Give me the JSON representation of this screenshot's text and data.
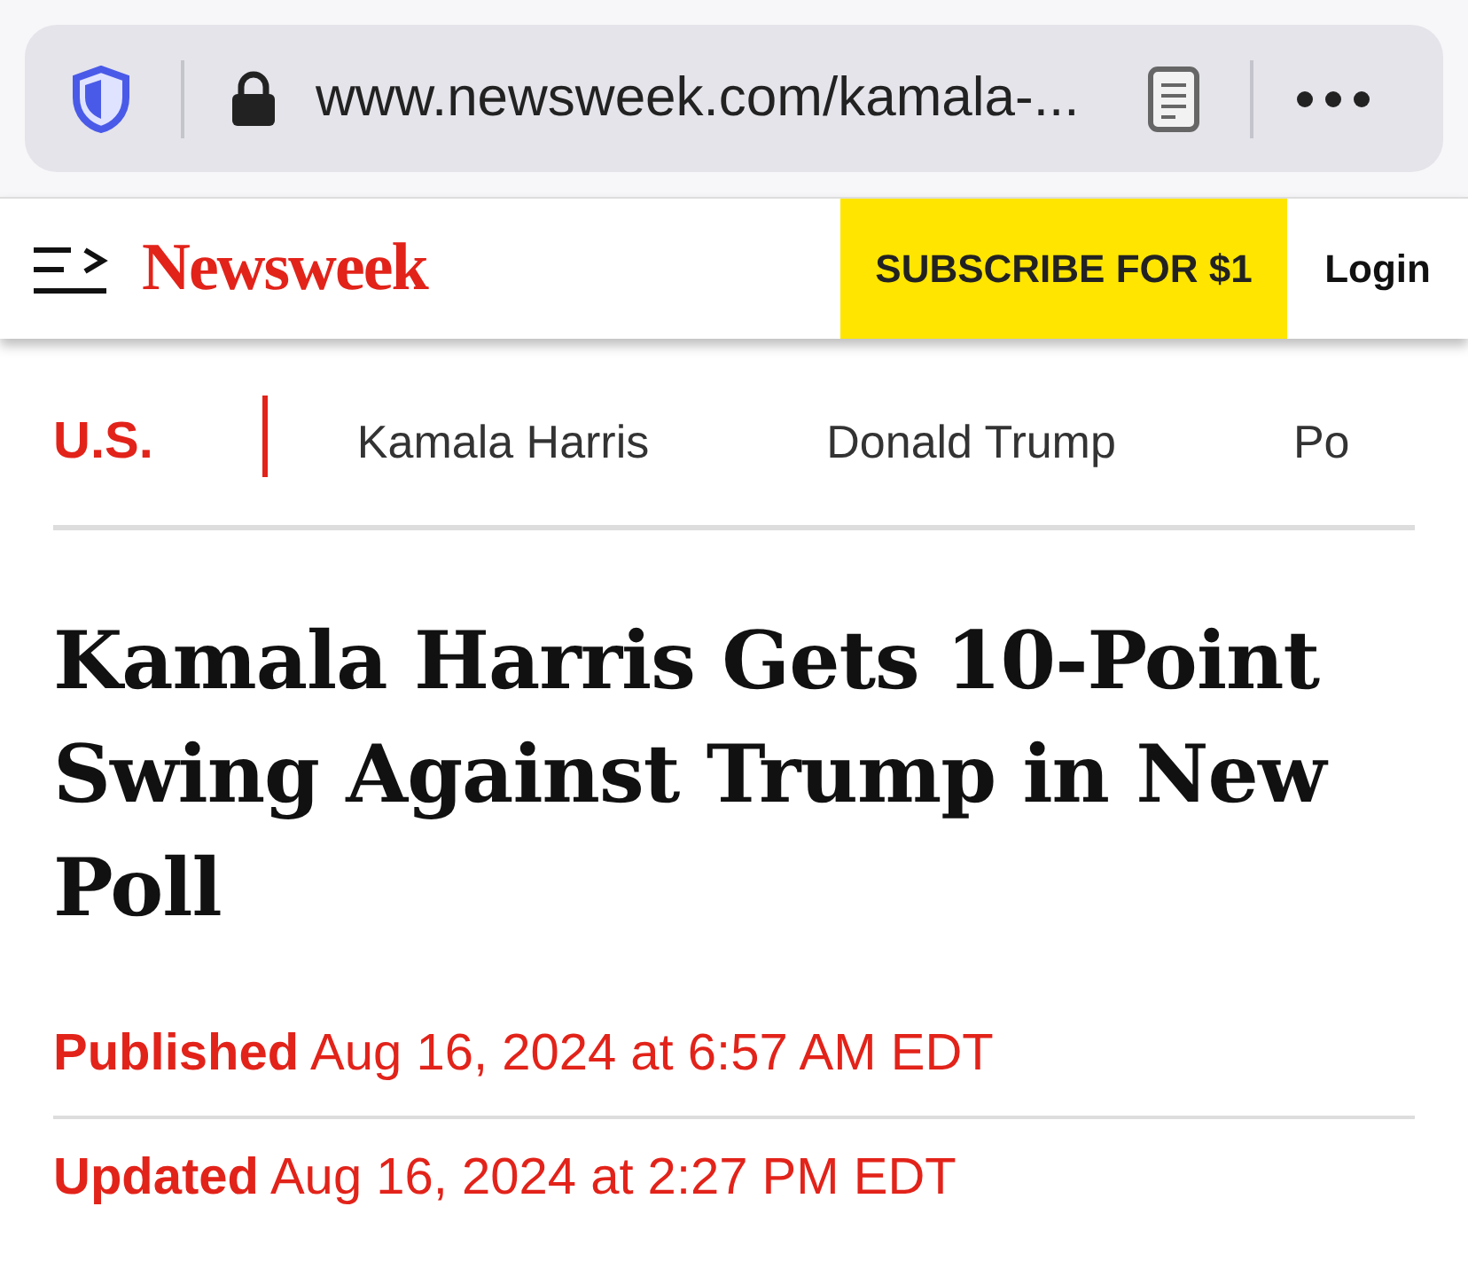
{
  "browser": {
    "url": "www.newsweek.com/kamala-..."
  },
  "header": {
    "logo": "Newsweek",
    "subscribe": "SUBSCRIBE FOR $1",
    "login": "Login"
  },
  "nav": {
    "section": "U.S.",
    "topics": [
      "Kamala Harris",
      "Donald Trump",
      "Po"
    ]
  },
  "article": {
    "headline": "Kamala Harris Gets 10-Point Swing Against Trump in New Poll",
    "dates": [
      {
        "label": "Published",
        "value": "Aug 16, 2024 at 6:57 AM EDT"
      },
      {
        "label": "Updated",
        "value": "Aug 16, 2024 at 2:27 PM EDT"
      }
    ]
  }
}
